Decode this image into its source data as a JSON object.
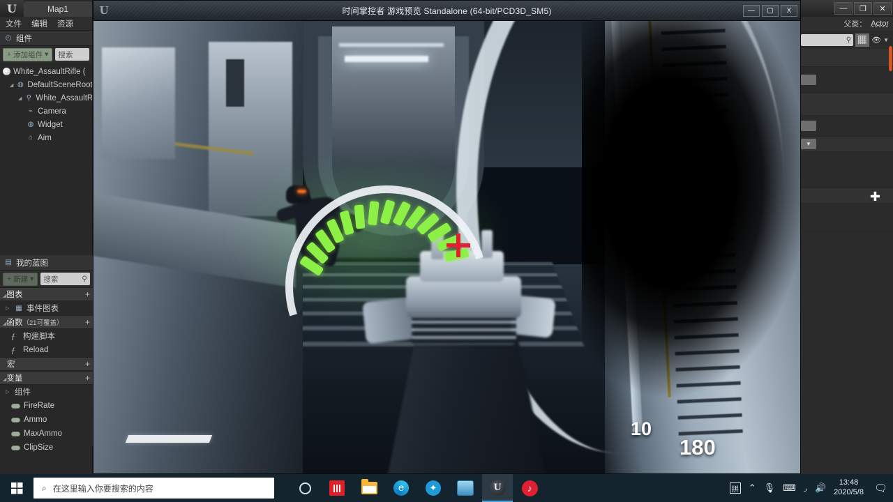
{
  "editor": {
    "tab_label": "Map1",
    "menu": [
      "文件",
      "编辑",
      "资源"
    ],
    "components_panel": {
      "title": "组件",
      "add_button": "添加组件",
      "search_placeholder": "搜索",
      "tree": [
        {
          "label": "White_AssaultRifle (",
          "indent": 0,
          "icon": "sphere-icon"
        },
        {
          "label": "DefaultSceneRoot",
          "indent": 1,
          "icon": "scene-root-icon"
        },
        {
          "label": "White_AssaultR",
          "indent": 2,
          "icon": "mesh-icon"
        },
        {
          "label": "Camera",
          "indent": 3,
          "icon": "camera-icon"
        },
        {
          "label": "Widget",
          "indent": 3,
          "icon": "widget-icon"
        },
        {
          "label": "Aim",
          "indent": 3,
          "icon": "aim-icon"
        }
      ]
    },
    "myblueprint_panel": {
      "title": "我的蓝图",
      "add_button": "新建",
      "search_placeholder": "搜索",
      "sections": [
        {
          "label": "图表",
          "sub": "",
          "items": [
            {
              "label": "事件图表",
              "icon": "graph-icon"
            }
          ]
        },
        {
          "label": "函数",
          "sub": "（21可覆盖）",
          "items": [
            {
              "label": "构建脚本",
              "icon": "construction-script-icon"
            },
            {
              "label": "Reload",
              "icon": "function-icon"
            }
          ]
        },
        {
          "label": "宏",
          "sub": "",
          "items": []
        },
        {
          "label": "变量",
          "sub": "",
          "items": [
            {
              "label": "组件",
              "icon": "category-icon"
            },
            {
              "label": "FireRate",
              "icon": "variable-icon"
            },
            {
              "label": "Ammo",
              "icon": "variable-icon"
            },
            {
              "label": "MaxAmmo",
              "icon": "variable-icon"
            },
            {
              "label": "ClipSize",
              "icon": "variable-icon"
            }
          ]
        }
      ]
    },
    "details_panel": {
      "parent_class_label": "父类：",
      "parent_class_value": "Actor",
      "search_placeholder": "",
      "minimize": "—",
      "maximize": "❐",
      "close": "✕"
    }
  },
  "game_window": {
    "title": "时间掌控者 游戏预览 Standalone (64-bit/PCD3D_SM5)",
    "minimize": "—",
    "maximize": "▢",
    "close": "X",
    "hud": {
      "clip_ammo": "10",
      "total_ammo": "180",
      "arc_tick_count": 14,
      "arc_color": "#8df046",
      "crosshair_color": "#e02030",
      "health_percent": 100
    }
  },
  "taskbar": {
    "search_placeholder": "在这里输入你要搜索的内容",
    "icons": [
      {
        "name": "cortana-icon",
        "label": "○"
      },
      {
        "name": "app-red-icon",
        "label": ""
      },
      {
        "name": "file-explorer-icon",
        "label": ""
      },
      {
        "name": "edge-browser-icon",
        "label": "e"
      },
      {
        "name": "app-blue-icon",
        "label": "S"
      },
      {
        "name": "photos-icon",
        "label": ""
      },
      {
        "name": "unreal-engine-icon",
        "label": "U"
      },
      {
        "name": "netease-music-icon",
        "label": "♪"
      }
    ],
    "tray": {
      "ime": "拼",
      "chevron": "⌃",
      "mic": "🎙",
      "keyboard": "⌨",
      "wifi": "📶",
      "volume": "🔊",
      "time": "13:48",
      "date": "2020/5/8",
      "notifications": "💬"
    }
  }
}
